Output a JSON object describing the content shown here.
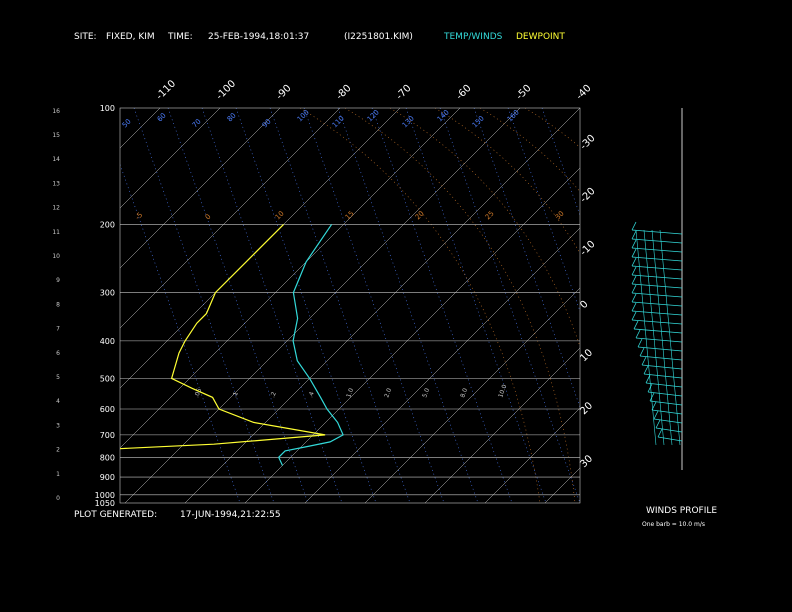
{
  "header": {
    "site_label": "SITE:",
    "site_value": "FIXED, KIM",
    "time_label": "TIME:",
    "time_value": "25-FEB-1994,18:01:37",
    "file_id": "(I2251801.KIM)",
    "legend_temp": "TEMP/WINDS",
    "legend_dew": "DEWPOINT"
  },
  "footer": {
    "generated_label": "PLOT GENERATED:",
    "generated_value": "17-JUN-1994,21:22:55",
    "winds_title": "WINDS PROFILE",
    "barb_note": "One barb = 10.0 m/s"
  },
  "colors": {
    "background": "#000000",
    "grid": "#c8c8c8",
    "temp": "#33d9d9",
    "dew": "#ffff33",
    "mixing": "#4d7fff",
    "dryadiabat": "#d07a2a",
    "header": "#ffffff"
  },
  "chart_data": {
    "type": "line",
    "subtype": "skew-T log-P",
    "pressure_levels": [
      100,
      200,
      300,
      400,
      500,
      600,
      700,
      800,
      900,
      1000,
      1050
    ],
    "height_ticks_km": [
      0,
      1,
      2,
      3,
      4,
      5,
      6,
      7,
      8,
      9,
      10,
      11,
      12,
      13,
      14,
      15,
      16
    ],
    "top_isotherm_labels": [
      "-110",
      "-100",
      "-90",
      "-80",
      "-70",
      "-60",
      "-50",
      "-40"
    ],
    "right_isotherm_labels": [
      "-30",
      "-20",
      "-10",
      "0",
      "10",
      "20",
      "30"
    ],
    "mixing_ratio_labels": [
      ".05",
      ".1",
      ".2",
      ".4",
      "1.0",
      "2.0",
      "5.0",
      "8.0",
      "10.0"
    ],
    "dry_adiabat_labels": [
      "50",
      "60",
      "70",
      "80",
      "90",
      "100",
      "110",
      "120",
      "130",
      "140",
      "150",
      "160"
    ],
    "theta_labels": [
      "-5",
      "0",
      "10",
      "15",
      "20",
      "25",
      "30"
    ],
    "series": [
      {
        "name": "TEMP/WINDS",
        "p": [
          200,
          250,
          300,
          350,
          400,
          450,
          500,
          560,
          600,
          650,
          700,
          730,
          750,
          770,
          800,
          840
        ],
        "t": [
          -62,
          -60,
          -57,
          -52,
          -49,
          -45,
          -40,
          -35,
          -32,
          -28,
          -25,
          -26,
          -29,
          -32,
          -32,
          -30
        ]
      },
      {
        "name": "DEWPOINT",
        "p": [
          200,
          250,
          300,
          340,
          360,
          400,
          430,
          500,
          530,
          560,
          600,
          650,
          700,
          740,
          760,
          800,
          830,
          850
        ],
        "t": [
          -70,
          -70,
          -70,
          -68,
          -68,
          -67,
          -66,
          -63,
          -58,
          -53,
          -50,
          -42,
          -28,
          -45,
          -60,
          -63,
          -62,
          -62
        ]
      }
    ],
    "wind_profile": {
      "title": "WINDS PROFILE",
      "levels": 24
    }
  }
}
